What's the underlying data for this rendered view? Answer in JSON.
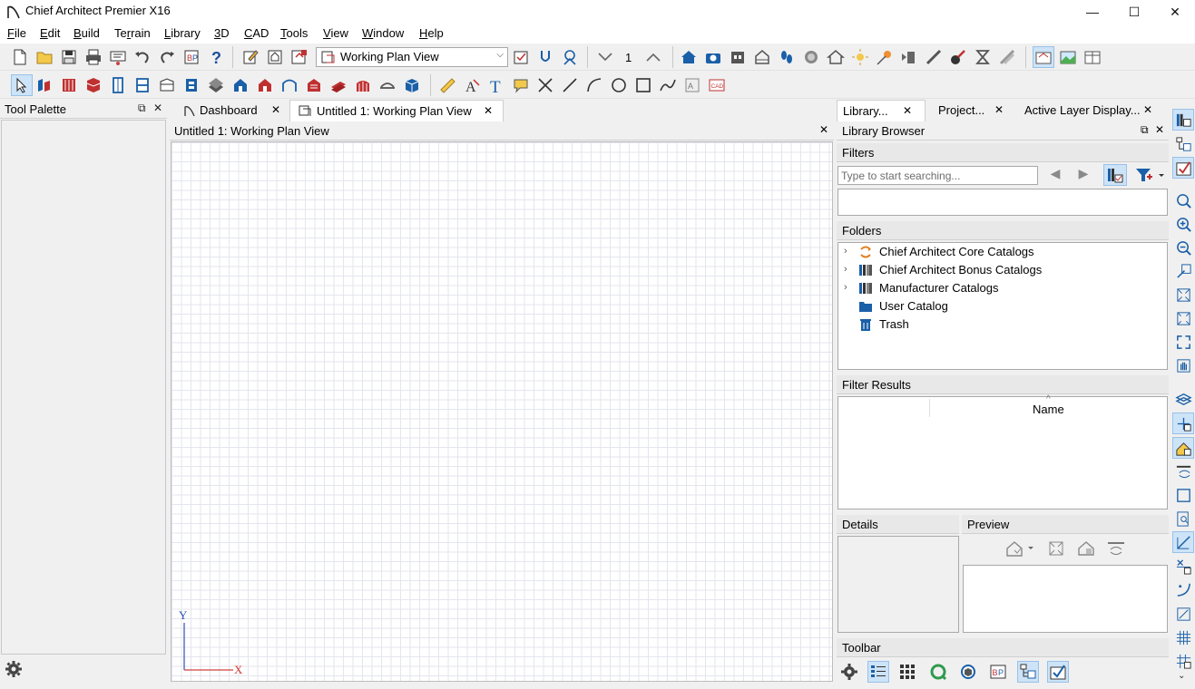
{
  "window": {
    "title": "Chief Architect Premier X16",
    "controls": {
      "minimize": "—",
      "maximize": "☐",
      "close": "✕"
    }
  },
  "menu": [
    {
      "label": "File",
      "accel": "F"
    },
    {
      "label": "Edit",
      "accel": "E"
    },
    {
      "label": "Build",
      "accel": "B"
    },
    {
      "label": "Terrain",
      "accel": "r"
    },
    {
      "label": "Library",
      "accel": "L"
    },
    {
      "label": "3D",
      "accel": "3"
    },
    {
      "label": "CAD",
      "accel": "C"
    },
    {
      "label": "Tools",
      "accel": "T"
    },
    {
      "label": "View",
      "accel": "V"
    },
    {
      "label": "Window",
      "accel": "W"
    },
    {
      "label": "Help",
      "accel": "H"
    }
  ],
  "toolbar": {
    "view_combo": "Working Plan View",
    "floor_number": "1"
  },
  "tool_palette": {
    "title": "Tool Palette"
  },
  "doc_tabs": [
    {
      "label": "Dashboard"
    },
    {
      "label": "Untitled 1:  Working Plan View"
    }
  ],
  "view": {
    "title": "Untitled 1:  Working Plan View",
    "axis_y": "Y",
    "axis_x": "X"
  },
  "right_tabs": [
    {
      "label": "Library..."
    },
    {
      "label": "Project..."
    },
    {
      "label": "Active Layer Display..."
    }
  ],
  "library_browser": {
    "title": "Library Browser",
    "filters_label": "Filters",
    "search_placeholder": "Type to start searching...",
    "folders_label": "Folders",
    "folders": [
      {
        "label": "Chief Architect Core Catalogs",
        "expandable": true,
        "icon": "core-catalog-icon"
      },
      {
        "label": "Chief Architect Bonus Catalogs",
        "expandable": true,
        "icon": "bonus-catalog-icon"
      },
      {
        "label": "Manufacturer Catalogs",
        "expandable": true,
        "icon": "manufacturer-catalog-icon"
      },
      {
        "label": "User Catalog",
        "expandable": false,
        "icon": "folder-icon"
      },
      {
        "label": "Trash",
        "expandable": false,
        "icon": "trash-icon"
      }
    ],
    "filter_results_label": "Filter Results",
    "results_column": "Name",
    "details_label": "Details",
    "preview_label": "Preview",
    "toolbar_label": "Toolbar"
  },
  "colors": {
    "accent_blue": "#1a5fa8",
    "selected_bg": "#cde3f7",
    "axis_red": "#d04040",
    "axis_blue": "#3050b0"
  }
}
